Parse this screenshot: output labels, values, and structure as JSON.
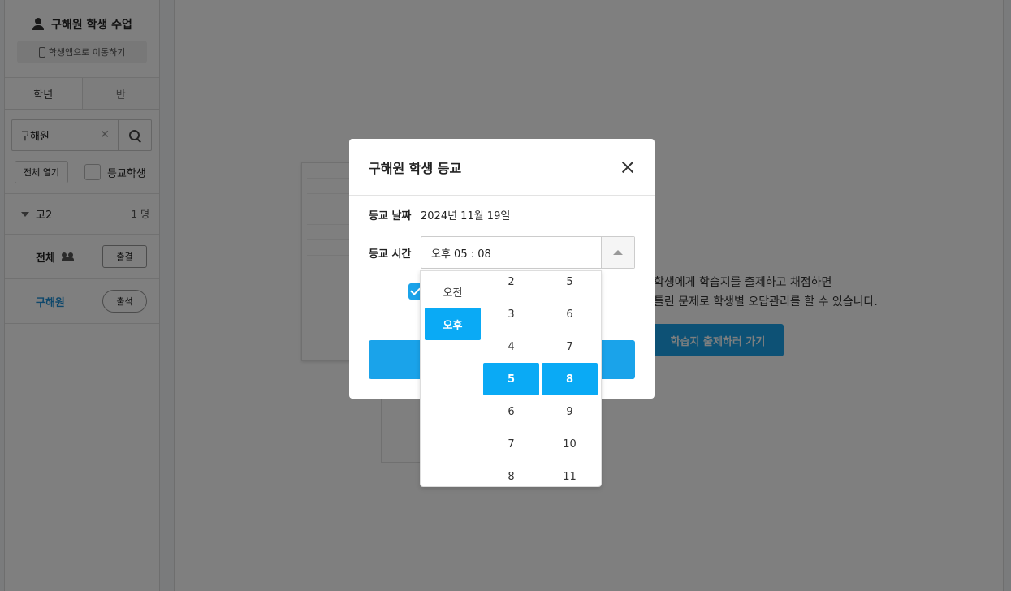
{
  "sidebar": {
    "profile_title": "구해원 학생 수업",
    "app_link": "학생앱으로 이동하기",
    "tabs": [
      "학년",
      "반"
    ],
    "search_value": "구해원",
    "open_all": "전체 열기",
    "filter_label": "등교학생",
    "group": {
      "name": "고2",
      "count": "1 명"
    },
    "all_row": {
      "label": "전체",
      "button": "출결"
    },
    "student_row": {
      "name": "구해원",
      "button": "출석"
    }
  },
  "main": {
    "empty_line1": "학생에게 학습지를 출제하고 채점하면",
    "empty_line2": "틀린 문제로 학생별 오답관리를 할 수 있습니다.",
    "cta": "학습지 출제하러 가기"
  },
  "modal": {
    "title": "구해원 학생 등교",
    "date_label": "등교 날짜",
    "date_value": "2024년 11월 19일",
    "time_label": "등교 시간",
    "time_value": "오후 05 : 08"
  },
  "picker": {
    "ampm": [
      "오전",
      "오후"
    ],
    "ampm_selected": "오후",
    "hours": [
      "2",
      "3",
      "4",
      "5",
      "6",
      "7",
      "8"
    ],
    "hour_selected": "5",
    "minutes": [
      "5",
      "6",
      "7",
      "8",
      "9",
      "10",
      "11"
    ],
    "minute_selected": "8"
  },
  "colors": {
    "accent": "#0aaaf5",
    "link": "#1c8fd6"
  }
}
